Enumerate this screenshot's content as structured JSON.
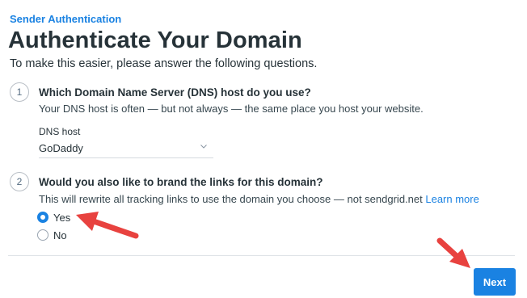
{
  "header": {
    "breadcrumb": "Sender Authentication",
    "title": "Authenticate Your Domain",
    "intro": "To make this easier, please answer the following questions."
  },
  "questions": [
    {
      "number": "1",
      "title": "Which Domain Name Server (DNS) host do you use?",
      "description": "Your DNS host is often — but not always — the same place you host your website.",
      "field_label": "DNS host",
      "selected_value": "GoDaddy"
    },
    {
      "number": "2",
      "title": "Would you also like to brand the links for this domain?",
      "description": "This will rewrite all tracking links to use the domain you choose — not sendgrid.net",
      "link_text": "Learn more",
      "options": [
        {
          "label": "Yes",
          "checked": true
        },
        {
          "label": "No",
          "checked": false
        }
      ]
    }
  ],
  "actions": {
    "next_label": "Next"
  },
  "colors": {
    "accent": "#1a82e2",
    "annotation_arrow": "#e8423f",
    "title_text": "#263238"
  },
  "icons": {
    "select_chevron": "chevron-down-icon",
    "annotation": "red-arrow-icon"
  }
}
